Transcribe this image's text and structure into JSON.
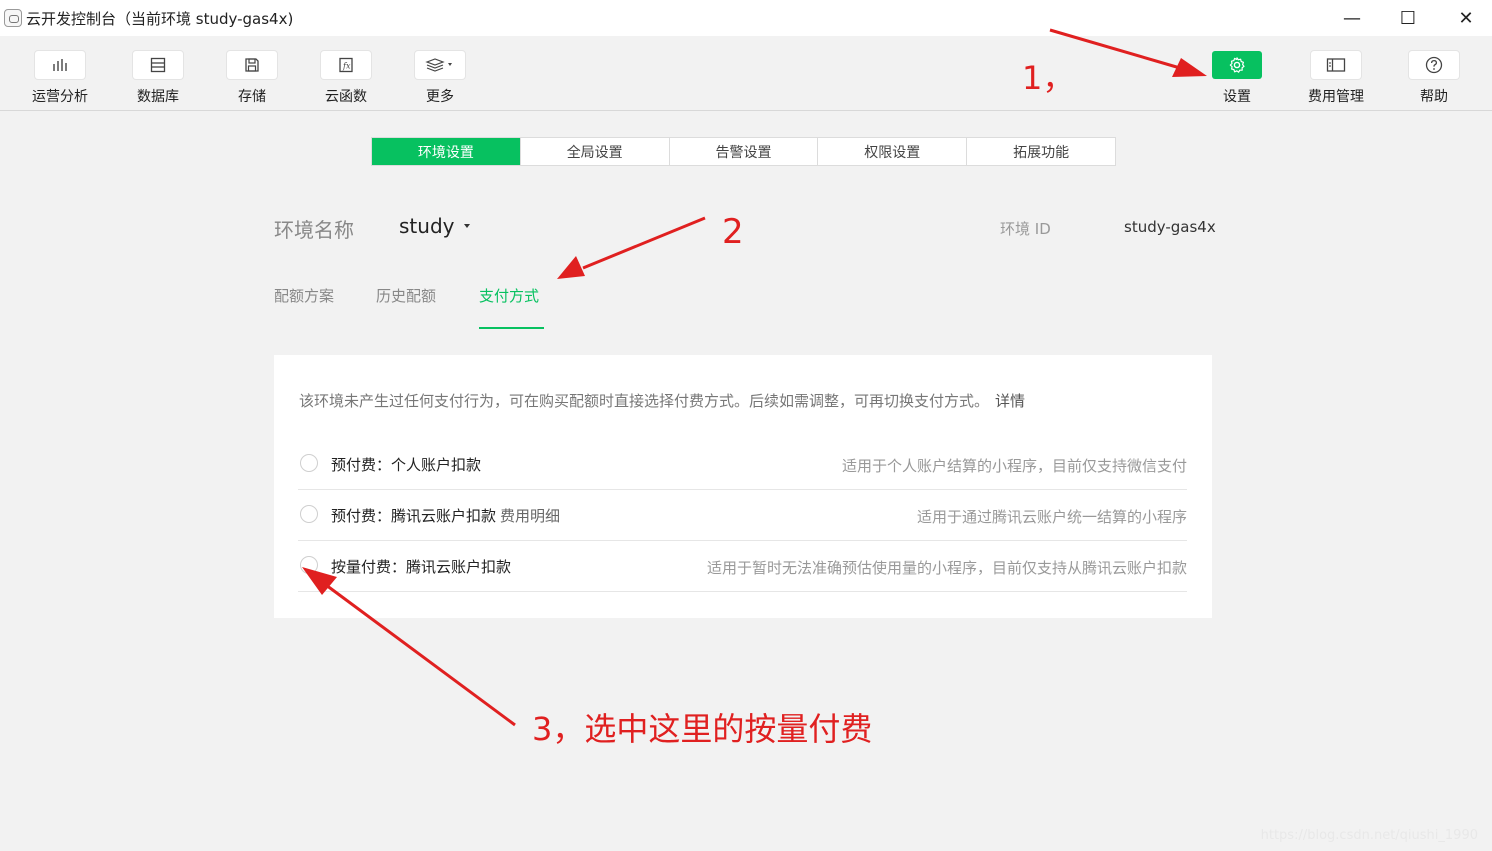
{
  "window": {
    "title": "云开发控制台（当前环境 study-gas4x)",
    "controls": {
      "minimize": "—",
      "maximize": "☐",
      "close": "✕"
    }
  },
  "toolbar": {
    "items": [
      {
        "label": "运营分析",
        "icon": "bar-chart-icon"
      },
      {
        "label": "数据库",
        "icon": "database-icon"
      },
      {
        "label": "存储",
        "icon": "storage-icon"
      },
      {
        "label": "云函数",
        "icon": "function-icon"
      },
      {
        "label": "更多",
        "icon": "layers-icon"
      }
    ],
    "right_items": [
      {
        "label": "设置",
        "icon": "gear-icon",
        "active": true
      },
      {
        "label": "费用管理",
        "icon": "billing-icon"
      },
      {
        "label": "帮助",
        "icon": "help-icon"
      }
    ]
  },
  "tabs": [
    "环境设置",
    "全局设置",
    "告警设置",
    "权限设置",
    "拓展功能"
  ],
  "env": {
    "name_label": "环境名称",
    "name_value": "study",
    "id_label": "环境 ID",
    "id_value": "study-gas4x"
  },
  "subtabs": [
    "配额方案",
    "历史配额",
    "支付方式"
  ],
  "payment": {
    "description": "该环境未产生过任何支付行为，可在购买配额时直接选择付费方式。后续如需调整，可再切换支付方式。",
    "detail_link": "详情",
    "options": [
      {
        "label": "预付费：个人账户扣款",
        "extra": "",
        "hint": "适用于个人账户结算的小程序，目前仅支持微信支付"
      },
      {
        "label": "预付费：腾讯云账户扣款",
        "extra": "费用明细",
        "hint": "适用于通过腾讯云账户统一结算的小程序"
      },
      {
        "label": "按量付费：腾讯云账户扣款",
        "extra": "",
        "hint": "适用于暂时无法准确预估使用量的小程序，目前仅支持从腾讯云账户扣款"
      }
    ]
  },
  "annotations": {
    "step1": "1，",
    "step2": "2",
    "step3": "3，选中这里的按量付费"
  },
  "watermark": "https://blog.csdn.net/qiushi_1990",
  "colors": {
    "accent": "#07c160",
    "annotation": "#e02020"
  }
}
